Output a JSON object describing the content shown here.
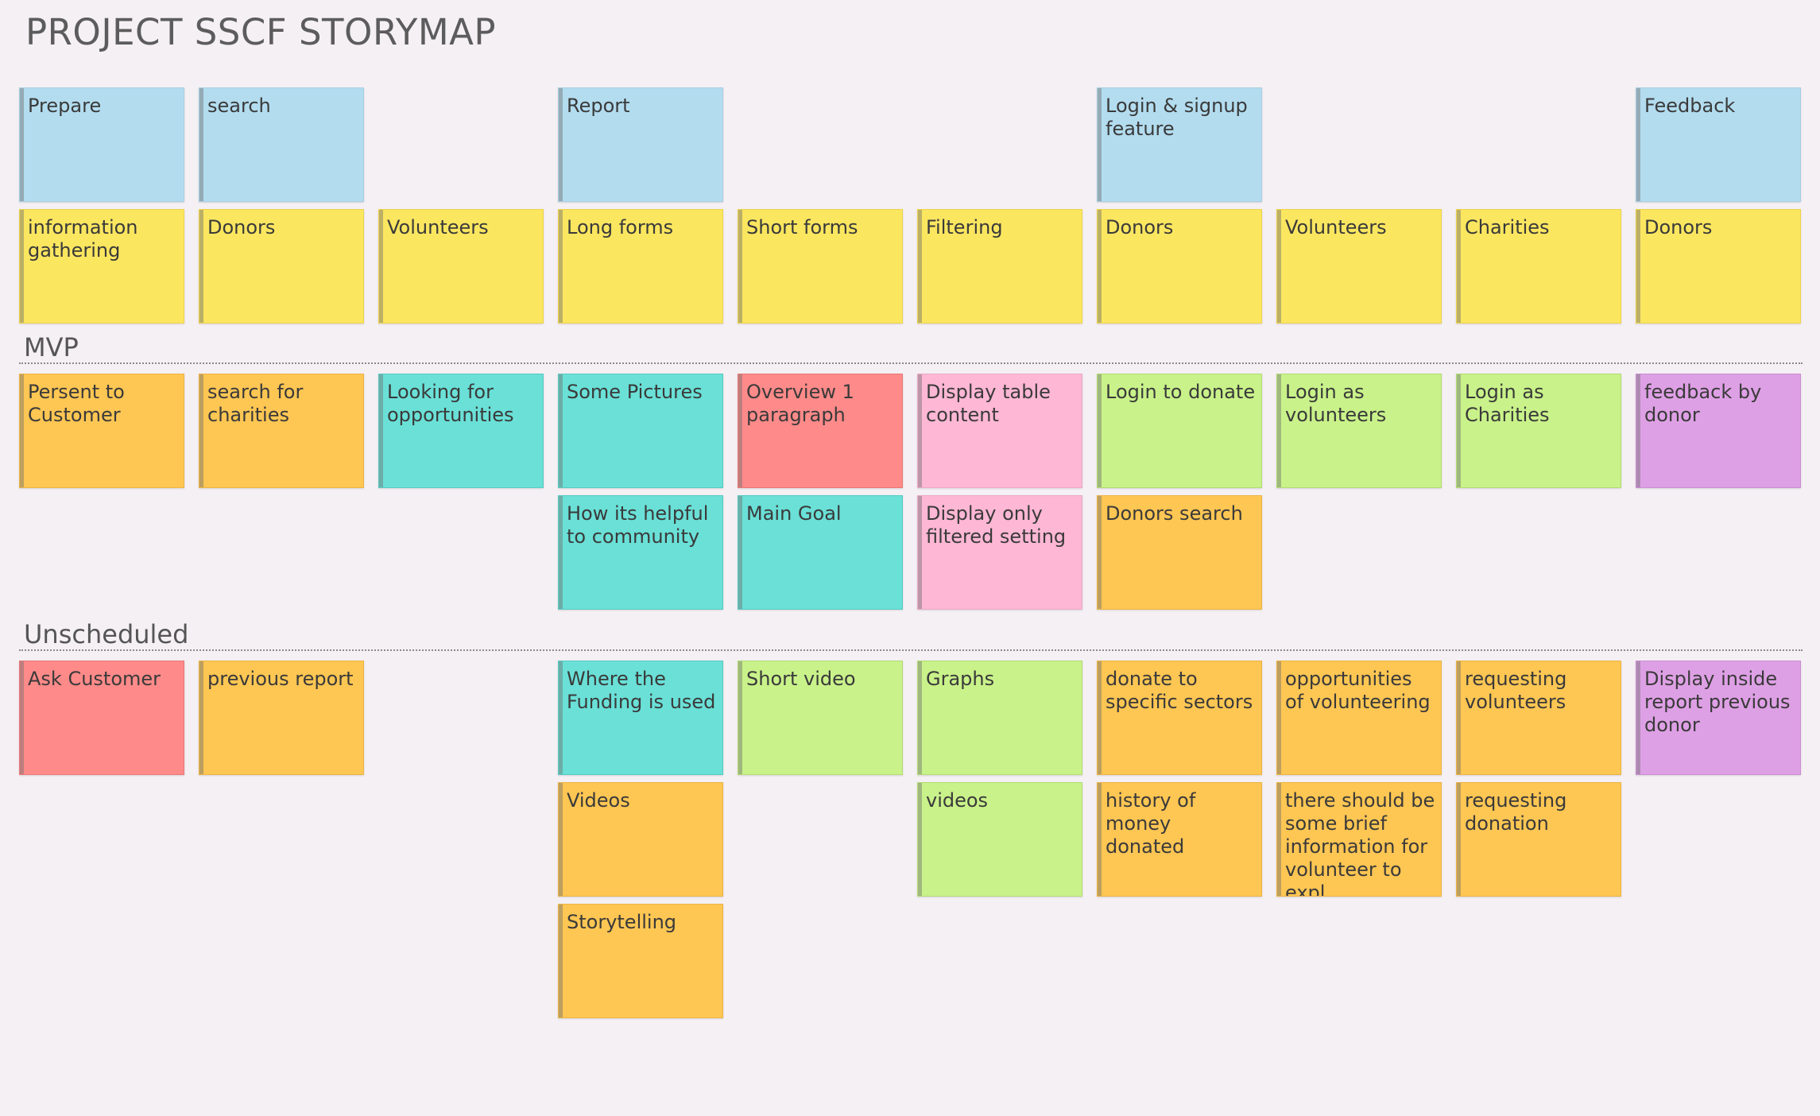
{
  "title": "PROJECT SSCF STORYMAP",
  "sections": {
    "mvp": "MVP",
    "unscheduled": "Unscheduled"
  },
  "colors": {
    "activity": "#b3dcef",
    "task": "#fbe660",
    "orange": "#fec653",
    "teal": "#6ae0d7",
    "red": "#fe8a89",
    "pink": "#feb7d4",
    "green": "#c9f28a",
    "purple": "#dea0e5"
  },
  "activities": [
    "Prepare",
    "search",
    "Report",
    "Login & signup feature",
    "Feedback"
  ],
  "tasks": [
    "information gathering",
    "Donors",
    "Volunteers",
    "Long forms",
    "Short forms",
    "Filtering",
    "Donors",
    "Volunteers",
    "Charities",
    "Donors"
  ],
  "mvp": [
    "Persent to Customer",
    "search for charities",
    "Looking for opportunities",
    "Some Pictures",
    "Overview 1 paragraph",
    "Display table content",
    "Login to donate",
    "Login as volunteers",
    "Login as Charities",
    "feedback by donor",
    "How its helpful to community",
    "Main Goal",
    "Display only filtered setting",
    "Donors search"
  ],
  "unscheduled": [
    "Ask Customer",
    "previous report",
    "Where the Funding is used",
    "Short video",
    "Graphs",
    "donate to specific sectors",
    "opportunities of volunteering",
    "requesting volunteers",
    "Display inside report  previous donor",
    "Videos",
    "videos",
    "history of money donated",
    "there should be some brief information for volunteer  to expl",
    "requesting donation",
    "Storytelling"
  ]
}
